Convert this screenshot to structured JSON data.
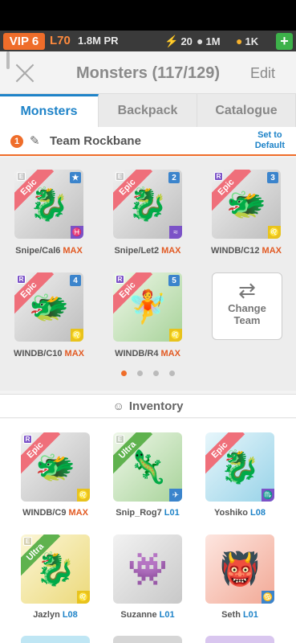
{
  "topbar": {
    "vip": "VIP 6",
    "level": "L70",
    "power": "1.8M PR",
    "energy": "20",
    "food": "1M",
    "coins": "1K",
    "plus": "+"
  },
  "header": {
    "title": "Monsters (117/129)",
    "edit": "Edit"
  },
  "tabs": [
    {
      "label": "Monsters",
      "active": true
    },
    {
      "label": "Backpack"
    },
    {
      "label": "Catalogue"
    }
  ],
  "team": {
    "number": "1",
    "name": "Team Rockbane",
    "set_default_line1": "Set to",
    "set_default_line2": "Default"
  },
  "team_monsters": [
    {
      "name": "Snipe/Cal6",
      "level": "MAX",
      "rarity": "Epic",
      "badge": "E",
      "slot": "★",
      "element": "♓"
    },
    {
      "name": "Snipe/Let2",
      "level": "MAX",
      "rarity": "Epic",
      "badge": "E",
      "slot": "2",
      "element": "≈"
    },
    {
      "name": "WINDB/C12",
      "level": "MAX",
      "rarity": "Epic",
      "badge": "R",
      "slot": "3",
      "element": "♌"
    },
    {
      "name": "WINDB/C10",
      "level": "MAX",
      "rarity": "Epic",
      "badge": "R",
      "slot": "4",
      "element": "♌"
    },
    {
      "name": "WINDB/R4",
      "level": "MAX",
      "rarity": "Epic",
      "badge": "R",
      "slot": "5",
      "element": "♌"
    }
  ],
  "change_team": {
    "line1": "Change",
    "line2": "Team"
  },
  "inventory": {
    "title": "Inventory",
    "items": [
      {
        "name": "WINDB/C9",
        "level": "MAX",
        "rarity": "Epic",
        "badge": "R",
        "element": "♌"
      },
      {
        "name": "Snip_Rog7",
        "level": "L01",
        "rarity": "Ultra",
        "badge": "E",
        "element": "✈"
      },
      {
        "name": "Yoshiko",
        "level": "L08",
        "rarity": "Epic",
        "badge": "",
        "element": "♏"
      },
      {
        "name": "Jazlyn",
        "level": "L08",
        "rarity": "Ultra",
        "badge": "E",
        "element": "♌"
      },
      {
        "name": "Suzanne",
        "level": "L01",
        "rarity": "",
        "badge": "",
        "element": ""
      },
      {
        "name": "Seth",
        "level": "L01",
        "rarity": "",
        "badge": "",
        "element": "♋"
      }
    ]
  },
  "colors": {
    "accent": "#ef6d2a",
    "tab_active": "#1e83c8",
    "max": "#e25a23"
  }
}
